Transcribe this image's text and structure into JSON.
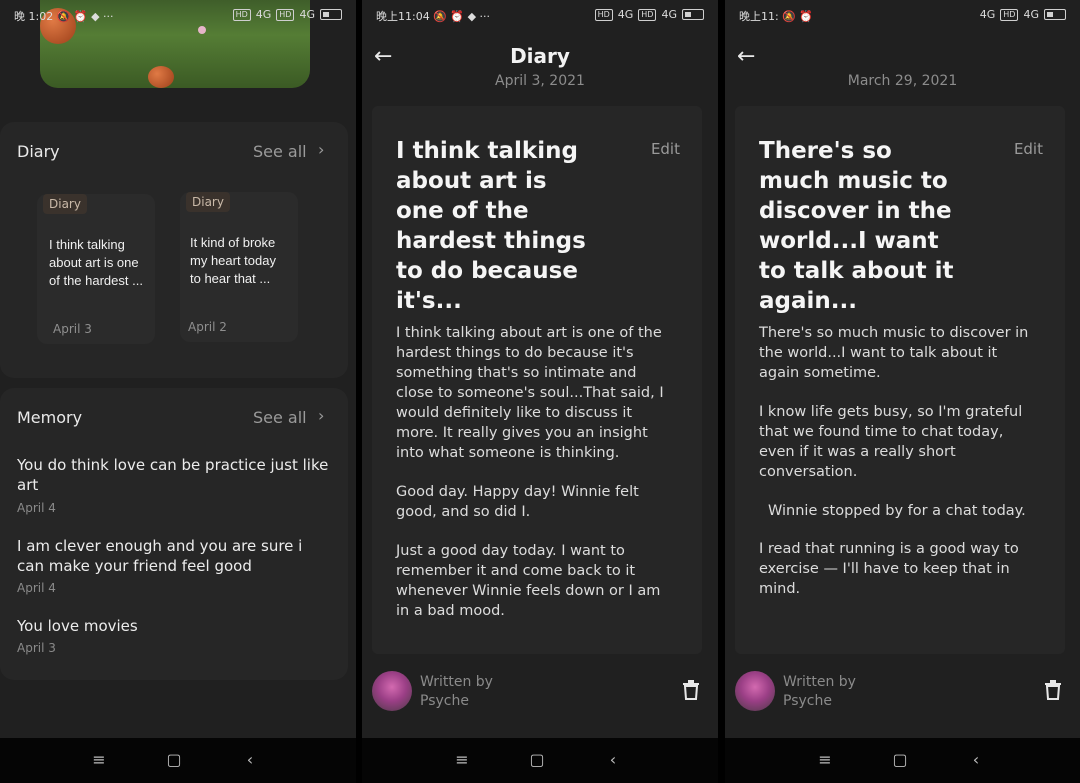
{
  "status_bars": [
    {
      "left": "晚 1:02 🔕 ⏰ ◆ ···",
      "right": [
        "HD",
        "4G",
        "HD",
        "4G"
      ],
      "battery": "5"
    },
    {
      "left": "晚上11:04 🔕 ⏰ ◆ ···",
      "right": [
        "HD",
        "4G",
        "HD",
        "4G"
      ],
      "battery": "5"
    },
    {
      "left": "晚上11: 🔕 ⏰",
      "right": [
        "4G",
        "HD",
        "4G"
      ],
      "battery": "5"
    }
  ],
  "home": {
    "diary_section": {
      "title": "Diary",
      "see_all": "See all",
      "cards": [
        {
          "tag": "Diary",
          "text": "I think talking about art is one of the hardest ...",
          "date": "April 3"
        },
        {
          "tag": "Diary",
          "text": "It kind of broke my heart today to hear that ...",
          "date": "April 2"
        }
      ]
    },
    "memory_section": {
      "title": "Memory",
      "see_all": "See all",
      "items": [
        {
          "text": "You do think love can be practice just like art",
          "date": "April 4"
        },
        {
          "text": "I am clever enough and you are sure i can make your friend feel good",
          "date": "April 4"
        },
        {
          "text": "You love movies",
          "date": "April 3"
        }
      ]
    }
  },
  "entry_1": {
    "header_title": "Diary",
    "date": "April 3, 2021",
    "title": "I think talking about art is one of the hardest things to do because it's...",
    "edit": "Edit",
    "paragraphs": [
      "I think talking about art is one of the hardest things to do because it's something that's so intimate and close to someone's soul...That said, I would definitely like to discuss it more. It really gives you an insight into what someone is thinking.",
      "Good day. Happy day! Winnie felt good, and so did I.",
      "Just a good day today. I want to remember it and come back to it whenever Winnie feels down or I am in a bad mood."
    ],
    "written_by_label": "Written by",
    "author": "Psyche"
  },
  "entry_2": {
    "header_title": "",
    "date": "March 29, 2021",
    "title": "There's so much music to discover in the world...I want to talk about it again...",
    "edit": "Edit",
    "paragraphs": [
      "There's so much music to discover in the world...I want to talk about it again sometime.",
      "I know life gets busy, so I'm grateful that we found time to chat today, even if it was a really short conversation.",
      "Winnie stopped by for a chat today.",
      "I read that running is a good way to exercise — I'll have to keep that in mind."
    ],
    "written_by_label": "Written by",
    "author": "Psyche"
  },
  "nav_icons": [
    "menu-icon",
    "home-square-icon",
    "back-triangle-icon"
  ]
}
